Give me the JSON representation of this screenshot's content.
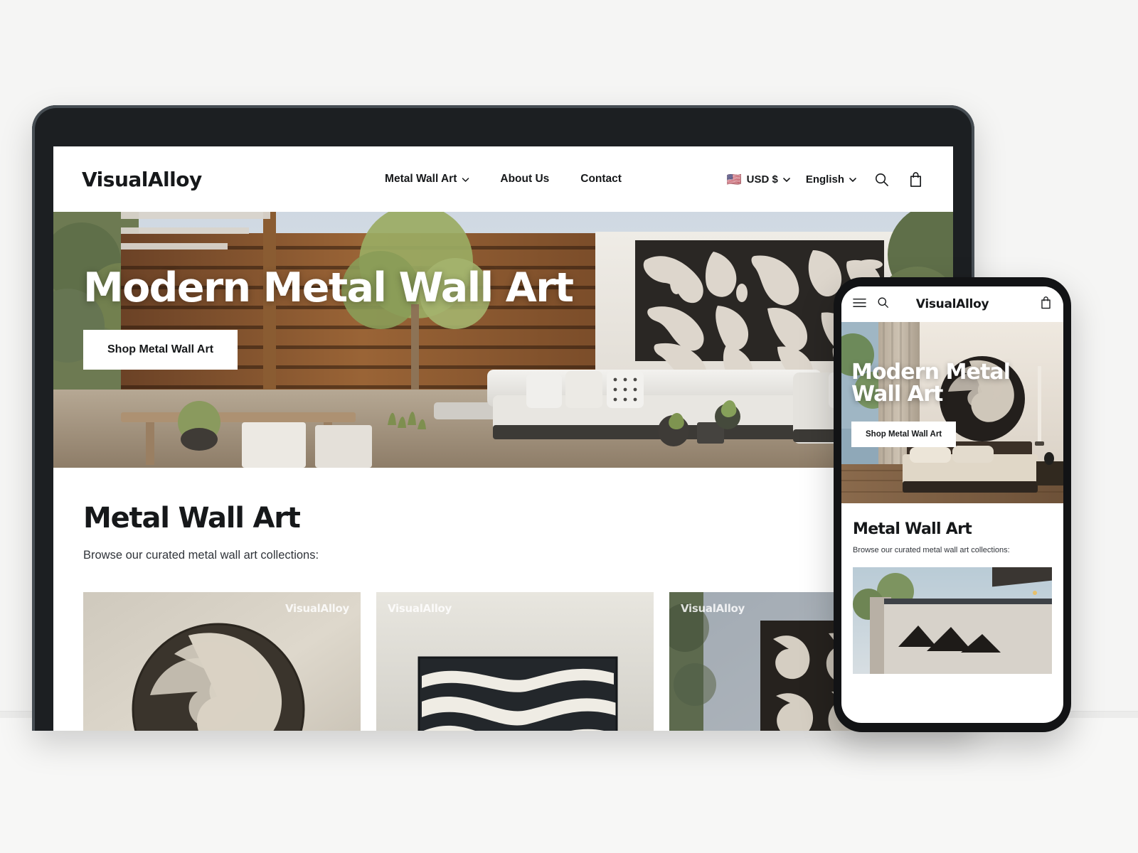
{
  "brand": {
    "name": "VisualAlloy",
    "accent": "#16181a"
  },
  "desktop": {
    "header": {
      "logo": "VisualAlloy",
      "nav": [
        {
          "label": "Metal Wall Art",
          "has_chevron": true
        },
        {
          "label": "About Us",
          "has_chevron": false
        },
        {
          "label": "Contact",
          "has_chevron": false
        }
      ],
      "currency": {
        "flag": "🇺🇸",
        "label": "USD $"
      },
      "language": {
        "label": "English"
      },
      "search_icon": "search-icon",
      "cart_icon": "shopping-bag-icon"
    },
    "hero": {
      "title": "Modern Metal Wall Art",
      "cta": "Shop Metal Wall Art"
    },
    "collection": {
      "title": "Metal Wall Art",
      "subtitle": "Browse our curated metal wall art collections:",
      "cards": [
        {
          "watermark": "VisualAlloy",
          "watermark_position": "right",
          "art": "swirl-circle"
        },
        {
          "watermark": "VisualAlloy",
          "watermark_position": "left",
          "art": "wave-panel"
        },
        {
          "watermark": "VisualAlloy",
          "watermark_position": "left",
          "art": "organic-outdoor-panel"
        }
      ]
    }
  },
  "mobile": {
    "header": {
      "menu_icon": "hamburger-menu-icon",
      "search_icon": "search-icon",
      "logo": "VisualAlloy",
      "cart_icon": "shopping-bag-icon"
    },
    "hero": {
      "title": "Modern Metal Wall Art",
      "cta": "Shop Metal Wall Art"
    },
    "collection": {
      "title": "Metal Wall Art",
      "subtitle": "Browse our curated metal wall art collections:"
    }
  }
}
